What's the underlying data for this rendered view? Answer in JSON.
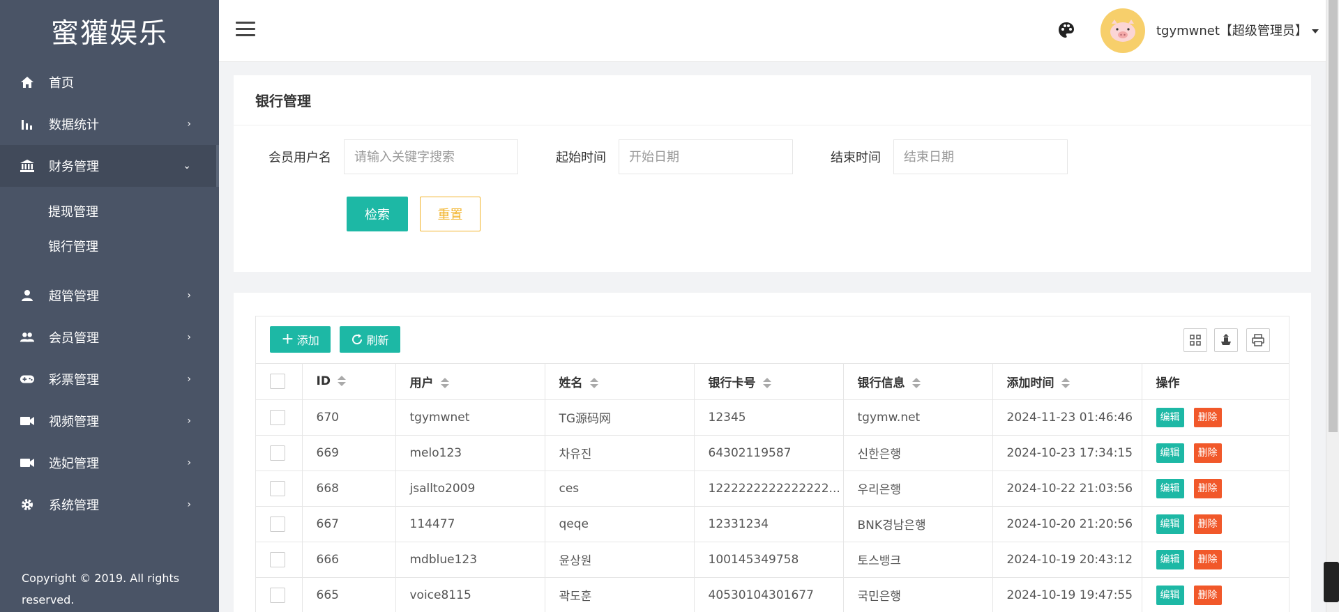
{
  "sidebar": {
    "brand": "蜜獾娱乐",
    "items": [
      {
        "label": "首页",
        "icon": "home-icon"
      },
      {
        "label": "数据统计",
        "icon": "bar-chart-icon"
      },
      {
        "label": "财务管理",
        "icon": "bank-icon"
      },
      {
        "label": "超管管理",
        "icon": "user-icon"
      },
      {
        "label": "会员管理",
        "icon": "users-icon"
      },
      {
        "label": "彩票管理",
        "icon": "gamepad-icon"
      },
      {
        "label": "视频管理",
        "icon": "video-icon"
      },
      {
        "label": "选妃管理",
        "icon": "video-icon"
      },
      {
        "label": "系统管理",
        "icon": "gear-icon"
      }
    ],
    "sub_items": [
      "提现管理",
      "银行管理"
    ],
    "copyright": "Copyright © 2019. All rights reserved."
  },
  "header": {
    "user": "tgymwnet【超级管理员】"
  },
  "search_card": {
    "title": "银行管理",
    "username_label": "会员用户名",
    "username_placeholder": "请输入关键字搜索",
    "start_label": "起始时间",
    "start_placeholder": "开始日期",
    "end_label": "结束时间",
    "end_placeholder": "结束日期",
    "search_btn": "检索",
    "reset_btn": "重置"
  },
  "table": {
    "add_btn": "添加",
    "refresh_btn": "刷新",
    "columns": [
      "ID",
      "用户",
      "姓名",
      "银行卡号",
      "银行信息",
      "添加时间",
      "操作"
    ],
    "edit_label": "编辑",
    "delete_label": "删除",
    "rows": [
      {
        "id": "670",
        "user": "tgymwnet",
        "name": "TG源码网",
        "card": "12345",
        "bank": "tgymw.net",
        "time": "2024-11-23 01:46:46"
      },
      {
        "id": "669",
        "user": "melo123",
        "name": "차유진",
        "card": "64302119587",
        "bank": "신한은행",
        "time": "2024-10-23 17:34:15"
      },
      {
        "id": "668",
        "user": "jsallto2009",
        "name": "ces",
        "card": "1222222222222222...",
        "bank": "우리은행",
        "time": "2024-10-22 21:03:56"
      },
      {
        "id": "667",
        "user": "114477",
        "name": "qeqe",
        "card": "12331234",
        "bank": "BNK경남은행",
        "time": "2024-10-20 21:20:56"
      },
      {
        "id": "666",
        "user": "mdblue123",
        "name": "윤상원",
        "card": "100145349758",
        "bank": "토스뱅크",
        "time": "2024-10-19 20:43:12"
      },
      {
        "id": "665",
        "user": "voice8115",
        "name": "곽도훈",
        "card": "40530104301677",
        "bank": "국민은행",
        "time": "2024-10-19 19:47:55"
      }
    ]
  },
  "colors": {
    "sidebar_bg": "#4a5466",
    "primary": "#1db8a5",
    "warning": "#f2b42b",
    "danger": "#f1582a"
  }
}
